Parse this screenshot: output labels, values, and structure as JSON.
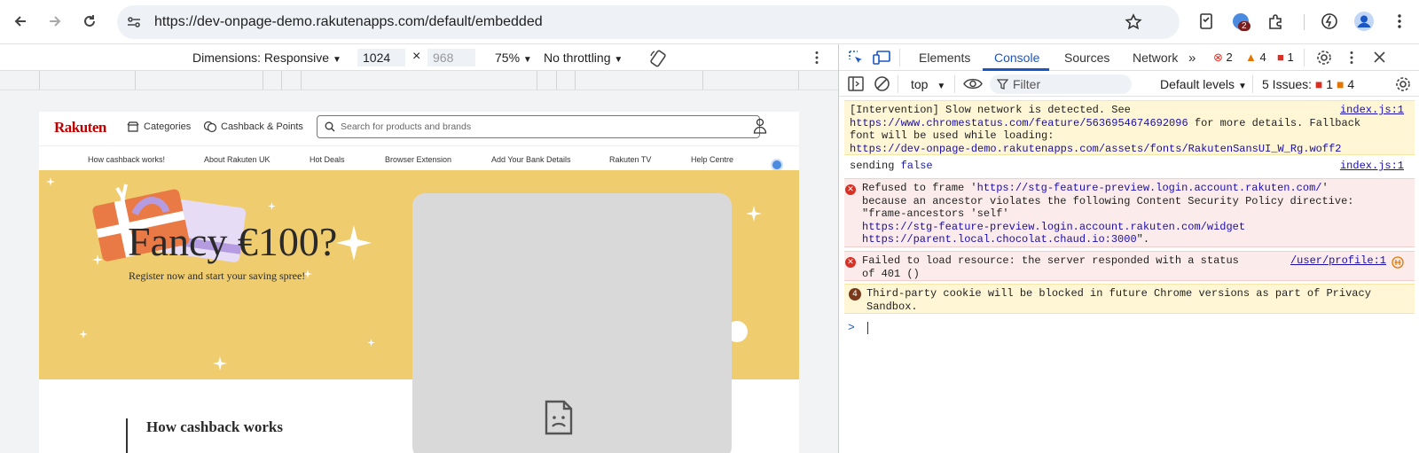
{
  "browser": {
    "url": "https://dev-onpage-demo.rakutenapps.com/default/embedded",
    "extension_badge": "2"
  },
  "device_toolbar": {
    "dimensions_label": "Dimensions: Responsive",
    "width": "1024",
    "height_placeholder": "968",
    "times": "×",
    "zoom": "75%",
    "throttling": "No throttling"
  },
  "rakuten": {
    "logo": "Rakuten",
    "categories": "Categories",
    "cashback": "Cashback & Points",
    "search_placeholder": "Search for products and brands",
    "subnav": [
      "How cashback works!",
      "About Rakuten UK",
      "Hot Deals",
      "Browser Extension",
      "Add Your Bank Details",
      "Rakuten TV",
      "Help Centre"
    ],
    "hero_title": "Fancy €100?",
    "hero_subtitle": "Register now and start your saving spree!",
    "how_title": "How cashback works"
  },
  "devtools": {
    "tabs": [
      "Elements",
      "Console",
      "Sources",
      "Network"
    ],
    "active_tab": "Console",
    "error_count": "2",
    "warning_count": "4",
    "issue_count": "1",
    "context": "top",
    "filter_placeholder": "Filter",
    "levels": "Default levels",
    "issues_label": "5 Issues:",
    "issues_err": "1",
    "issues_warn": "4",
    "messages": [
      {
        "type": "warning",
        "line1": "[Intervention] Slow network is detected. See",
        "link1": "https://www.chromestatus.com/feature/5636954674692096",
        "line2_rest": " for more details. Fallback",
        "line3": "font will be used while loading:",
        "link2": "https://dev-onpage-demo.rakutenapps.com/assets/fonts/RakutenSansUI_W_Rg.woff2",
        "source": "index.js:1"
      },
      {
        "type": "log",
        "text": "sending ",
        "value": "false",
        "source": "index.js:1"
      },
      {
        "type": "error",
        "line1_pre": "Refused to frame '",
        "link1": "https://stg-feature-preview.login.account.rakuten.com/",
        "line1_post": "'",
        "line2": "because an ancestor violates the following Content Security Policy directive:",
        "line3": "\"frame-ancestors 'self'",
        "link2": "https://stg-feature-preview.login.account.rakuten.com/widget",
        "link3": "https://parent.local.chocolat.chaud.io:3000",
        "line5_post": "\"."
      },
      {
        "type": "error",
        "line1": "Failed to load resource: the server responded with a status",
        "line2": "of 401 ()",
        "source": "/user/profile:1"
      },
      {
        "type": "issue",
        "badge": "4",
        "line1": "Third-party cookie will be blocked in future Chrome versions as part of Privacy",
        "line2": "Sandbox."
      }
    ],
    "prompt": ">"
  }
}
